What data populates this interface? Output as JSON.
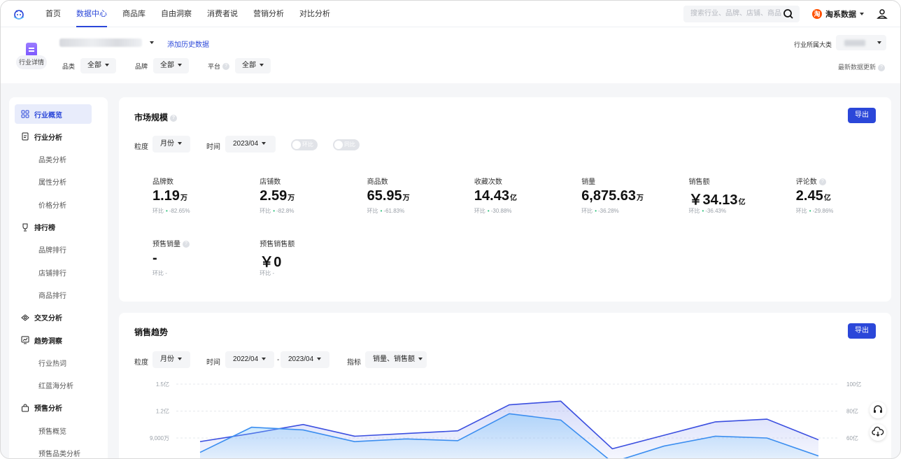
{
  "nav": {
    "items": [
      "首页",
      "数据中心",
      "商品库",
      "自由洞察",
      "消费者说",
      "营销分析",
      "对比分析"
    ],
    "active_index": 1,
    "search_placeholder": "搜索行业、品牌、店铺、商品",
    "system_badge": "淘",
    "system_label": "淘系数据"
  },
  "header": {
    "industry_tag": "行业详情",
    "history_link": "添加历史数据",
    "filters": [
      {
        "label": "品类",
        "value": "全部"
      },
      {
        "label": "品牌",
        "value": "全部"
      },
      {
        "label": "平台",
        "value": "全部"
      }
    ],
    "industry_category_label": "行业所属大类",
    "latest_update": "最新数据更新"
  },
  "sidebar": {
    "items": [
      {
        "label": "行业概览",
        "type": "group",
        "icon": "grid-icon",
        "active": true
      },
      {
        "label": "行业分析",
        "type": "group",
        "icon": "document-icon"
      },
      {
        "label": "品类分析",
        "type": "sub"
      },
      {
        "label": "属性分析",
        "type": "sub"
      },
      {
        "label": "价格分析",
        "type": "sub"
      },
      {
        "label": "排行榜",
        "type": "group",
        "icon": "trophy-icon"
      },
      {
        "label": "品牌排行",
        "type": "sub"
      },
      {
        "label": "店铺排行",
        "type": "sub"
      },
      {
        "label": "商品排行",
        "type": "sub"
      },
      {
        "label": "交叉分析",
        "type": "group",
        "icon": "cross-icon"
      },
      {
        "label": "趋势洞察",
        "type": "group",
        "icon": "trend-icon"
      },
      {
        "label": "行业热词",
        "type": "sub"
      },
      {
        "label": "红蓝海分析",
        "type": "sub"
      },
      {
        "label": "预售分析",
        "type": "group",
        "icon": "bag-icon"
      },
      {
        "label": "预售概览",
        "type": "sub"
      },
      {
        "label": "预售品类分析",
        "type": "sub"
      }
    ]
  },
  "market": {
    "title": "市场规模",
    "export": "导出",
    "granularity_label": "粒度",
    "granularity_value": "月份",
    "time_label": "时间",
    "time_value": "2023/04",
    "toggle_mom": "环比",
    "toggle_yoy": "同比",
    "metrics": [
      {
        "label": "品牌数",
        "value": "1.19",
        "unit": "万",
        "cmp_label": "环比",
        "cmp": "-82.65%"
      },
      {
        "label": "店铺数",
        "value": "2.59",
        "unit": "万",
        "cmp_label": "环比",
        "cmp": "-82.8%"
      },
      {
        "label": "商品数",
        "value": "65.95",
        "unit": "万",
        "cmp_label": "环比",
        "cmp": "-61.83%"
      },
      {
        "label": "收藏次数",
        "value": "14.43",
        "unit": "亿",
        "cmp_label": "环比",
        "cmp": "-30.88%"
      },
      {
        "label": "销量",
        "value": "6,875.63",
        "unit": "万",
        "cmp_label": "环比",
        "cmp": "-36.28%"
      },
      {
        "label": "销售额",
        "value": "￥34.13",
        "unit": "亿",
        "cmp_label": "环比",
        "cmp": "-36.43%"
      },
      {
        "label": "评论数",
        "value": "2.45",
        "unit": "亿",
        "cmp_label": "环比",
        "cmp": "-29.86%"
      },
      {
        "label": "预售销量",
        "value": "-",
        "unit": "",
        "cmp_label": "环比",
        "cmp": "-"
      },
      {
        "label": "预售销售额",
        "value": "￥0",
        "unit": "",
        "cmp_label": "环比",
        "cmp": "-"
      }
    ]
  },
  "trend": {
    "title": "销售趋势",
    "export": "导出",
    "granularity_label": "粒度",
    "granularity_value": "月份",
    "time_label": "时间",
    "time_start": "2022/04",
    "time_sep": "-",
    "time_end": "2023/04",
    "metric_label": "指标",
    "metric_value": "销量、销售额"
  },
  "chart_data": {
    "type": "area",
    "y_left_ticks": [
      "1.5亿",
      "1.2亿",
      "9,000万"
    ],
    "y_right_ticks": [
      "100亿",
      "80亿",
      "60亿"
    ],
    "series": [
      {
        "values": [
          0.86,
          0.95,
          1.05,
          0.92,
          0.95,
          0.98,
          1.27,
          1.31,
          0.78,
          0.93,
          1.08,
          1.11,
          0.88
        ]
      },
      {
        "values": [
          0.74,
          1.02,
          0.99,
          0.86,
          0.89,
          0.87,
          1.17,
          1.1,
          0.63,
          0.81,
          0.92,
          0.9,
          0.7
        ]
      }
    ],
    "colors": {
      "line1": "#3b4fe0",
      "line2": "#3b8ef0"
    },
    "ylim": [
      0.6,
      1.6
    ]
  }
}
